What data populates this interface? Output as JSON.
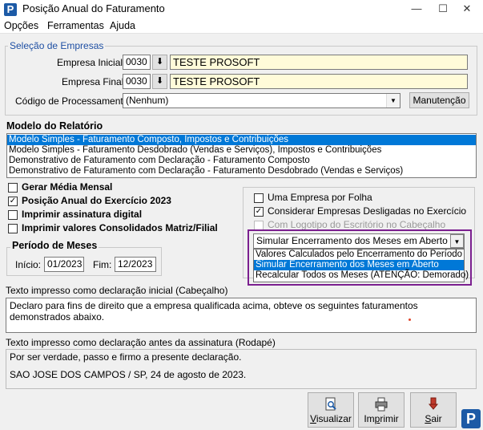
{
  "window": {
    "title": "Posição Anual do Faturamento",
    "minimize": "—",
    "maximize": "☐",
    "close": "✕",
    "app_icon_letter": "P"
  },
  "menu": [
    "Opções",
    "Ferramentas",
    "Ajuda"
  ],
  "empresas": {
    "legend": "Seleção de Empresas",
    "inicial_label": "Empresa Inicial",
    "inicial_code": "0030",
    "inicial_name": "TESTE PROSOFT",
    "final_label": "Empresa Final",
    "final_code": "0030",
    "final_name": "TESTE PROSOFT",
    "codigo_label": "Código de Processamento",
    "codigo_value": "(Nenhum)",
    "manutencao": "Manutenção"
  },
  "modelo": {
    "title": "Modelo do Relatório",
    "items": [
      "Modelo Simples - Faturamento Composto, Impostos e Contribuições",
      "Modelo Simples - Faturamento Desdobrado (Vendas e Serviços), Impostos e Contribuições",
      "Demonstrativo de Faturamento com Declaração - Faturamento Composto",
      "Demonstrativo de Faturamento com Declaração - Faturamento Desdobrado (Vendas e Serviços)"
    ],
    "selected_index": 0
  },
  "left_options": [
    {
      "label": "Gerar Média Mensal",
      "checked": false
    },
    {
      "label": "Posição Anual do Exercício 2023",
      "checked": true
    },
    {
      "label": "Imprimir assinatura digital",
      "checked": false
    },
    {
      "label": "Imprimir valores Consolidados Matriz/Filial",
      "checked": false
    }
  ],
  "periodo": {
    "title": "Período de Meses",
    "inicio_label": "Início:",
    "inicio_value": "01/2023",
    "fim_label": "Fim:",
    "fim_value": "12/2023"
  },
  "right_options": [
    {
      "label": "Uma Empresa por Folha",
      "checked": false,
      "disabled": false
    },
    {
      "label": "Considerar Empresas Desligadas no Exercício",
      "checked": true,
      "disabled": false
    },
    {
      "label": "Com Logotipo do Escritório no Cabeçalho",
      "checked": false,
      "disabled": true
    }
  ],
  "encerramento": {
    "selected": "Simular Encerramento dos Meses em Aberto",
    "options": [
      "Valores Calculados pelo Encerramento do Período",
      "Simular Encerramento dos Meses em Aberto",
      "Recalcular Todos os Meses (ATENÇÃO: Demorado)"
    ],
    "highlighted_index": 1
  },
  "cabecalho": {
    "label": "Texto impresso como declaração inicial (Cabeçalho)",
    "text": "Declaro para fins de direito que a empresa qualificada acima, obteve os seguintes faturamentos demonstrados abaixo."
  },
  "rodape": {
    "label": "Texto impresso como declaração antes da assinatura (Rodapé)",
    "line1": "Por ser verdade, passo e firmo a presente declaração.",
    "line2": "SAO JOSE DOS CAMPOS / SP, 24 de agosto de 2023."
  },
  "buttons": {
    "visualizar_u": "V",
    "visualizar_rest": "isualizar",
    "imprimir_pre": "Im",
    "imprimir_u": "p",
    "imprimir_rest": "rimir",
    "sair_u": "S",
    "sair_rest": "air"
  },
  "colors": {
    "selection": "#0078d7",
    "highlight_border": "#7b1f8f",
    "legend_blue": "#1e4fa3",
    "name_field": "#fffbd9"
  }
}
